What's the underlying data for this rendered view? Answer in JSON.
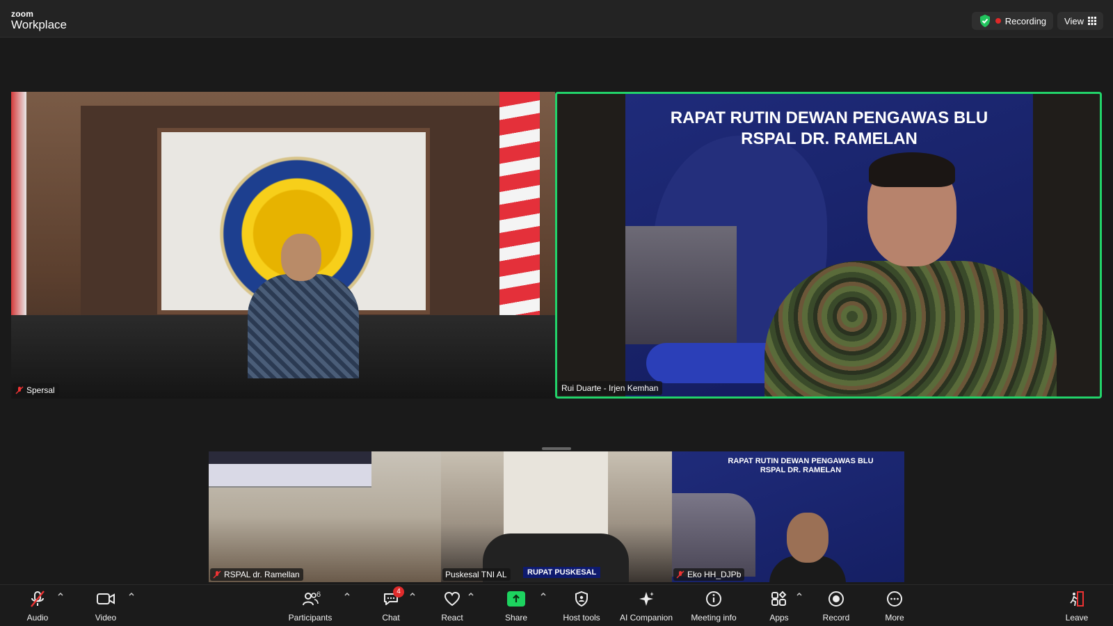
{
  "brand": {
    "line1": "zoom",
    "line2": "Workplace"
  },
  "top_right": {
    "recording_label": "Recording",
    "view_label": "View",
    "shield_color": "#22c55e",
    "rec_color": "#e02828"
  },
  "tiles": {
    "spersal": {
      "label": "Spersal",
      "muted": true
    },
    "rui": {
      "label": "Rui Duarte -  Irjen Kemhan",
      "muted": false,
      "active_speaker_color": "#22d36a",
      "slide_title_1": "RAPAT RUTIN DEWAN PENGAWAS BLU",
      "slide_title_2": "RSPAL DR. RAMELAN"
    }
  },
  "strip": [
    {
      "label": "RSPAL dr. Ramellan",
      "muted": true
    },
    {
      "label": "Puskesal TNI AL",
      "muted": false,
      "banner": "RUPAT PUSKESAL"
    },
    {
      "label": "Eko HH_DJPb",
      "muted": true,
      "slide_title_1": "RAPAT RUTIN DEWAN PENGAWAS BLU",
      "slide_title_2": "RSPAL DR. RAMELAN"
    }
  ],
  "toolbar": {
    "audio": "Audio",
    "video": "Video",
    "participants": "Participants",
    "participants_count": "6",
    "chat": "Chat",
    "chat_badge": "4",
    "react": "React",
    "share": "Share",
    "host_tools": "Host tools",
    "ai_companion": "AI Companion",
    "meeting_info": "Meeting info",
    "apps": "Apps",
    "record": "Record",
    "more": "More",
    "leave": "Leave"
  }
}
